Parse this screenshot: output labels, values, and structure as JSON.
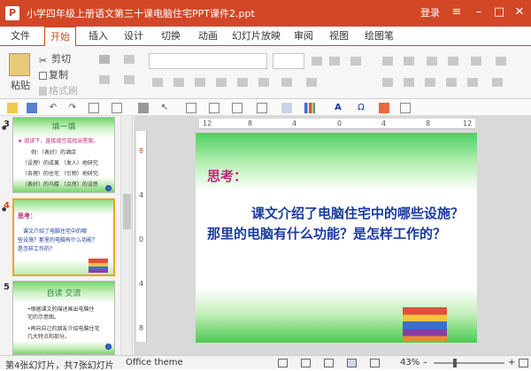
{
  "title_bar": {
    "app_icon": "P",
    "title": "小学四年级上册语文第三十课电脑住宅PPT课件2.ppt",
    "login": "登录",
    "menu_icon": "menu-icon",
    "minimize_icon": "minimize-icon",
    "maximize_icon": "maximize-icon",
    "close_icon": "close-icon"
  },
  "tabs": [
    "文件",
    "开始",
    "插入",
    "设计",
    "切换",
    "动画",
    "幻灯片放映",
    "审阅",
    "视图",
    "绘图笔"
  ],
  "active_tab": "开始",
  "ribbon": {
    "paste": "粘贴",
    "cut": "剪切",
    "copy": "复制",
    "format_painter": "格式刷"
  },
  "thumbnails": [
    {
      "number": "3",
      "title": "填一填",
      "lines": [
        "★ 阅读下，直接填空或找出答案。",
        "例：（表好）的酒店",
        "（设理）的成果 （发人）地研究",
        "（各理）的住宅 （引物）地研究",
        "（表好）的乌楼 （点然）的设思"
      ]
    },
    {
      "number": "4",
      "title": "思考：",
      "lines": [
        "课文介绍了电脑住宅中的哪",
        "些设施？那里的电脑有什么功能？",
        "是怎样工作的？"
      ]
    },
    {
      "number": "5",
      "title": "自读 交流",
      "lines": [
        "•根据课文的描述画出电脑住",
        "宅的示意图。",
        "•再向自己的朋友介绍电脑住宅",
        "几大特点和部分。"
      ]
    }
  ],
  "slide": {
    "heading": "思考：",
    "body": "课文介绍了电脑住宅中的哪些设施？那里的电脑有什么功能？是怎样工作的？"
  },
  "ruler_labels": [
    "12",
    "8",
    "4",
    "0",
    "4",
    "8",
    "12"
  ],
  "vruler_labels": [
    "8",
    "4",
    "0",
    "4",
    "8"
  ],
  "status": {
    "slide_info": "第4张幻灯片，共7张幻灯片",
    "theme": "Office theme",
    "zoom": "43%"
  }
}
